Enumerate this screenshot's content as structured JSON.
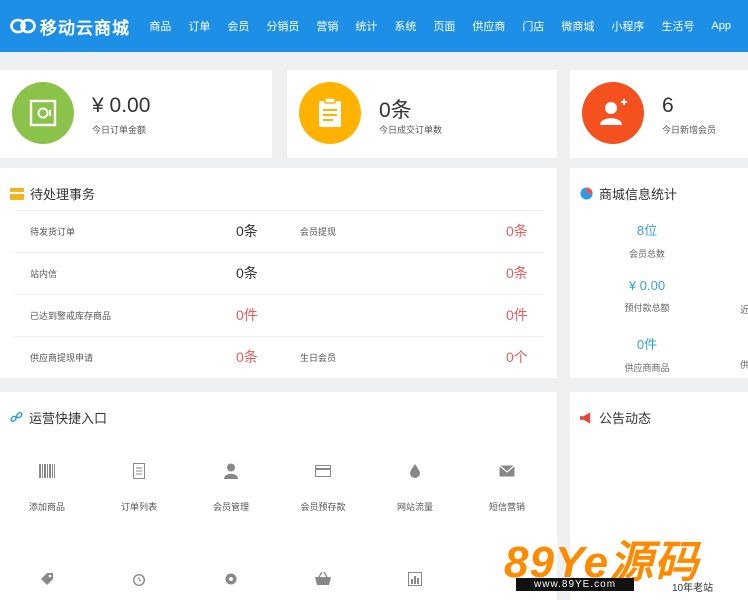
{
  "brand": {
    "name": "移动云商城"
  },
  "nav": [
    "商品",
    "订单",
    "会员",
    "分销员",
    "营销",
    "统计",
    "系统",
    "页面",
    "供应商",
    "门店",
    "微商城",
    "小程序",
    "生活号",
    "App"
  ],
  "stats": [
    {
      "value": "¥ 0.00",
      "label": "今日订单金额",
      "color": "#8bc34a"
    },
    {
      "value": "0条",
      "label": "今日成交订单数",
      "color": "#ffb300"
    },
    {
      "value": "6",
      "label": "今日新增会员",
      "color": "#f4511e"
    }
  ],
  "pending": {
    "title": "待处理事务",
    "rows": [
      {
        "label1": "待发货订单",
        "value1": "0条",
        "label2": "会员提现",
        "value2": "0条"
      },
      {
        "label1": "站内信",
        "value1": "0条",
        "label2": "",
        "value2": "0条"
      },
      {
        "label1": "已达到警戒库存商品",
        "value1": "0件",
        "label2": "",
        "value2": "0件"
      },
      {
        "label1": "供应商提现申请",
        "value1": "0条",
        "label2": "生日会员",
        "value2": "0个"
      }
    ]
  },
  "mallstats": {
    "title": "商城信息统计",
    "items": [
      {
        "value": "8位",
        "label": "会员总数"
      },
      {
        "value": "¥ 0.00",
        "label": "预付款总额"
      },
      {
        "value": "0件",
        "label": "供应商商品"
      }
    ],
    "cut_labels": [
      "近",
      "供"
    ]
  },
  "quick": {
    "title": "运营快捷入口",
    "items": [
      {
        "label": "添加商品",
        "icon": "barcode-icon"
      },
      {
        "label": "订单列表",
        "icon": "list-icon"
      },
      {
        "label": "会员管理",
        "icon": "user-icon"
      },
      {
        "label": "会员预存款",
        "icon": "card-icon"
      },
      {
        "label": "网站流量",
        "icon": "drop-icon"
      },
      {
        "label": "短信营销",
        "icon": "mail-icon"
      }
    ],
    "row2_icons": [
      "tag-icon",
      "alarm-icon",
      "gear-icon",
      "basket-icon",
      "chart-icon"
    ]
  },
  "notice": {
    "title": "公告动态"
  },
  "watermark": {
    "text": "89Ye源码",
    "url": "www.89YE.com",
    "years": "10年老站"
  }
}
